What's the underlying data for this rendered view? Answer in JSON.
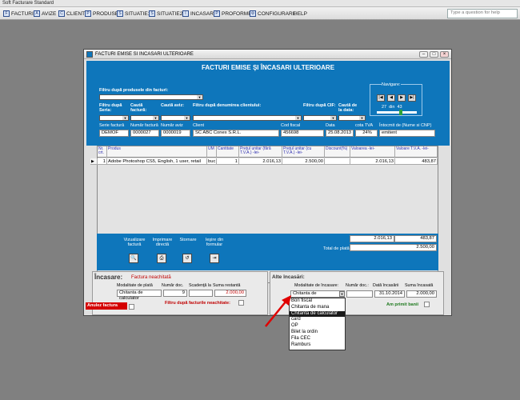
{
  "app": {
    "title": "Soft Facturare Standard"
  },
  "menu": [
    {
      "label": "FACTURI",
      "icon": "invoice-icon"
    },
    {
      "label": "AVIZE",
      "icon": "notice-icon"
    },
    {
      "label": "CLIENTI",
      "icon": "clients-icon"
    },
    {
      "label": "PRODUSE",
      "icon": "products-icon"
    },
    {
      "label": "SITUATIE1",
      "icon": "report-icon"
    },
    {
      "label": "SITUATIE2",
      "icon": "report-icon"
    },
    {
      "label": "INCASARI",
      "icon": "cash-icon"
    },
    {
      "label": "PROFORME",
      "icon": "proforma-icon"
    },
    {
      "label": "CONFIGURARE",
      "icon": "settings-icon"
    },
    {
      "label": "HELP",
      "icon": ""
    }
  ],
  "help_search": {
    "placeholder": "Type a question for help"
  },
  "window": {
    "title": "FACTURI EMISE SI INCASARI ULTERIOARE",
    "heading": "FACTURI EMISE ŞI ÎNCASARI ULTERIOARE",
    "buttons": {
      "min": "–",
      "max": "□",
      "close": "×"
    }
  },
  "filters": {
    "by_product": "Filtru după produsele din facturi:",
    "by_series": "Filtru după Seria:",
    "search_invoice": "Caută factură:",
    "search_notice": "Caută aviz:",
    "by_client": "Filtru după denumirea clientului:",
    "by_cif": "Filtru după CIF:",
    "by_date": "Caută de la data:"
  },
  "navigation": {
    "label": "Navigare:",
    "current": "27",
    "of": "din",
    "total": "43",
    "first": "|◀",
    "prev": "◀",
    "next": "▶",
    "last": "▶|"
  },
  "invoice": {
    "labels": {
      "series": "Serie factură",
      "number": "Număr factură",
      "notice": "Număr aviz",
      "client": "Client",
      "fiscal": "Cod fiscal",
      "date": "Data",
      "vat": "cota TVA",
      "author": "Întocmit de (Nume si CNP)"
    },
    "values": {
      "series": "DEMOF",
      "number": "0000027",
      "notice": "0000019",
      "client": "SC ABC Conex S.R.L.",
      "fiscal": "456698",
      "date": "25.08.2013",
      "vat": "24%",
      "author": "emitent"
    }
  },
  "grid": {
    "headers": [
      "Nr. crt.",
      "Produs",
      "UM",
      "Cantitate",
      "Preţul unitar (fără T.V.A.) -lei-",
      "Preţul unitar (cu T.V.A.) -lei-",
      "Discount(%)",
      "Valoarea -lei-",
      "Valoare T.V.A. -lei-"
    ],
    "rows": [
      [
        "1",
        "Adobe Photoshop CS5, English, 1 user, retail",
        "buc",
        "1",
        "2.016,13",
        "2.500,00",
        "",
        "2.016,13",
        "483,87"
      ]
    ],
    "row_marker": "▶"
  },
  "toolbar": {
    "view": "Vizualizare factură",
    "print": "Imprimare directă",
    "storno": "Stornare",
    "exit": "Ieşire din formular"
  },
  "totals": {
    "value": "2.016,13",
    "vat": "483,87",
    "total_label": "Total de plată:",
    "total": "2.500,00"
  },
  "incasare": {
    "title": "Încasare:",
    "status": "Factura neachitată",
    "labels": {
      "mode": "Modalitate de plată",
      "doc": "Număr doc.",
      "due": "Scadenţă la",
      "remaining": "Suma restantă"
    },
    "values": {
      "mode": "Chitanta de calculator",
      "doc": "9",
      "due": "",
      "remaining": "2.000,00"
    },
    "cancel_label": "Anulez factura",
    "filter_unpaid": "Filtru după facturile neachitate:"
  },
  "alte": {
    "title": "Alte încasări:",
    "labels": {
      "mode": "Modalitate de încasare:",
      "doc": "Număr doc.:",
      "date": "Dată încasării",
      "sum": "Suma încasată"
    },
    "values": {
      "mode": "Chitanta de calculator",
      "doc": "",
      "date": "31.10.2014",
      "sum": "2.000,00"
    },
    "received": "Am primit banii",
    "options": [
      "Bon fiscal",
      "Chitanta de mana",
      "Chitanta de calculator",
      "card",
      "OP",
      "Bilet la ordin",
      "Fila CEC",
      "Ramburs"
    ],
    "selected_index": 2
  }
}
